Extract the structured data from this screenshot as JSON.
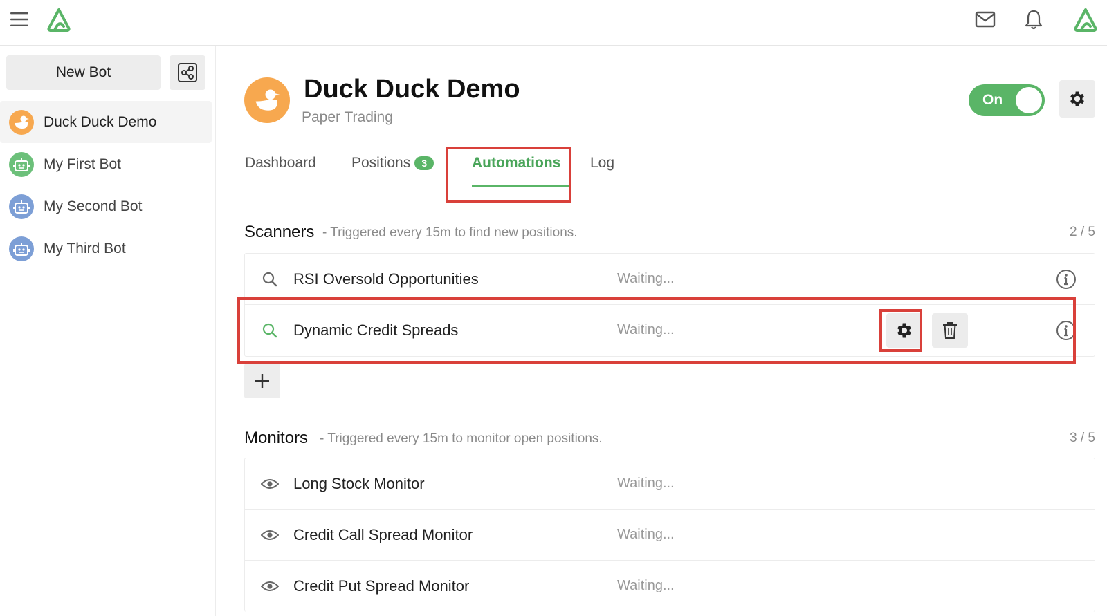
{
  "colors": {
    "brand_green": "#5ab567",
    "duck_orange": "#f7a84f",
    "bot_green": "#6cc07a",
    "bot_blue": "#7d9fd6",
    "highlight_red": "#d9403a"
  },
  "topbar": {
    "menu_icon": "hamburger-icon",
    "logo_icon": "brand-logo-icon",
    "mail_icon": "mail-icon",
    "bell_icon": "bell-icon",
    "account_icon": "brand-logo-icon"
  },
  "sidebar": {
    "new_bot_label": "New Bot",
    "share_icon": "share-icon",
    "bots": [
      {
        "label": "Duck Duck Demo",
        "icon": "duck-icon",
        "active": true
      },
      {
        "label": "My First Bot",
        "icon": "robot-icon",
        "active": false
      },
      {
        "label": "My Second Bot",
        "icon": "robot-icon",
        "active": false
      },
      {
        "label": "My Third Bot",
        "icon": "robot-icon",
        "active": false
      }
    ]
  },
  "bot": {
    "title": "Duck Duck Demo",
    "subtitle": "Paper Trading",
    "toggle_label": "On",
    "toggle_on": true
  },
  "tabs": [
    {
      "label": "Dashboard"
    },
    {
      "label": "Positions",
      "badge": "3"
    },
    {
      "label": "Automations",
      "active": true
    },
    {
      "label": "Log"
    }
  ],
  "scanners": {
    "title": "Scanners",
    "description": "- Triggered every 15m to find new positions.",
    "count": "2 / 5",
    "rows": [
      {
        "name": "RSI Oversold Opportunities",
        "status": "Waiting..."
      },
      {
        "name": "Dynamic Credit Spreads",
        "status": "Waiting..."
      }
    ]
  },
  "monitors": {
    "title": "Monitors",
    "description": "- Triggered every 15m to monitor open positions.",
    "count": "3 / 5",
    "rows": [
      {
        "name": "Long Stock Monitor",
        "status": "Waiting..."
      },
      {
        "name": "Credit Call Spread Monitor",
        "status": "Waiting..."
      },
      {
        "name": "Credit Put Spread Monitor",
        "status": "Waiting..."
      }
    ]
  }
}
